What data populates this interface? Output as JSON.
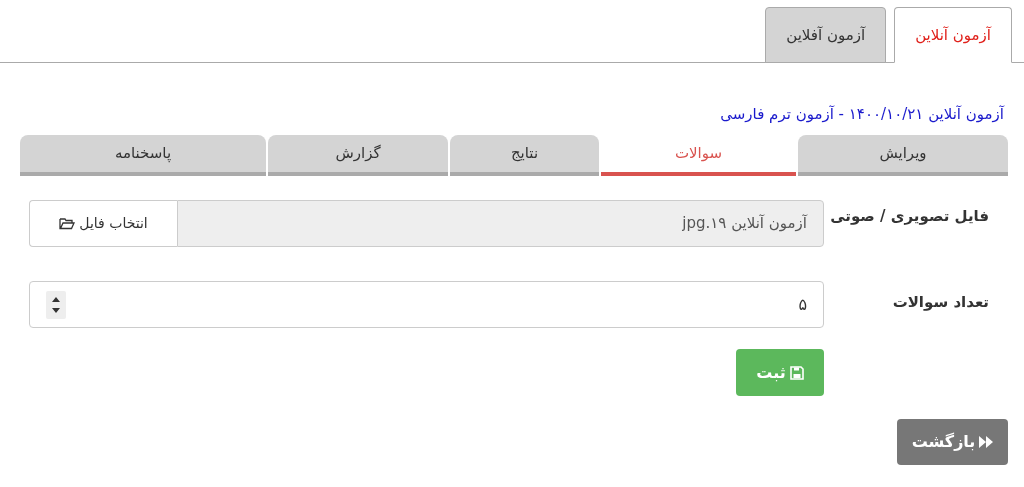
{
  "top_tabs": [
    {
      "label": "آزمون آنلاین",
      "selected": true
    },
    {
      "label": "آزمون آفلاین",
      "selected": false
    }
  ],
  "heading": "آزمون آنلاین ۱۴۰۰/۱۰/۲۱ - آزمون ترم فارسی",
  "sub_tabs": [
    {
      "label": "ویرایش",
      "selected": false
    },
    {
      "label": "سوالات",
      "selected": true
    },
    {
      "label": "نتایج",
      "selected": false
    },
    {
      "label": "گزارش",
      "selected": false
    },
    {
      "label": "پاسخنامه",
      "selected": false
    }
  ],
  "form": {
    "file_label": "فایل تصویری / صوتی",
    "file_value": "آزمون آنلاین ۱۹.jpg",
    "browse_button": "انتخاب فایل",
    "count_label": "تعداد سوالات",
    "count_value": "۵",
    "submit_button": "ثبت"
  },
  "back_button": "بازگشت"
}
